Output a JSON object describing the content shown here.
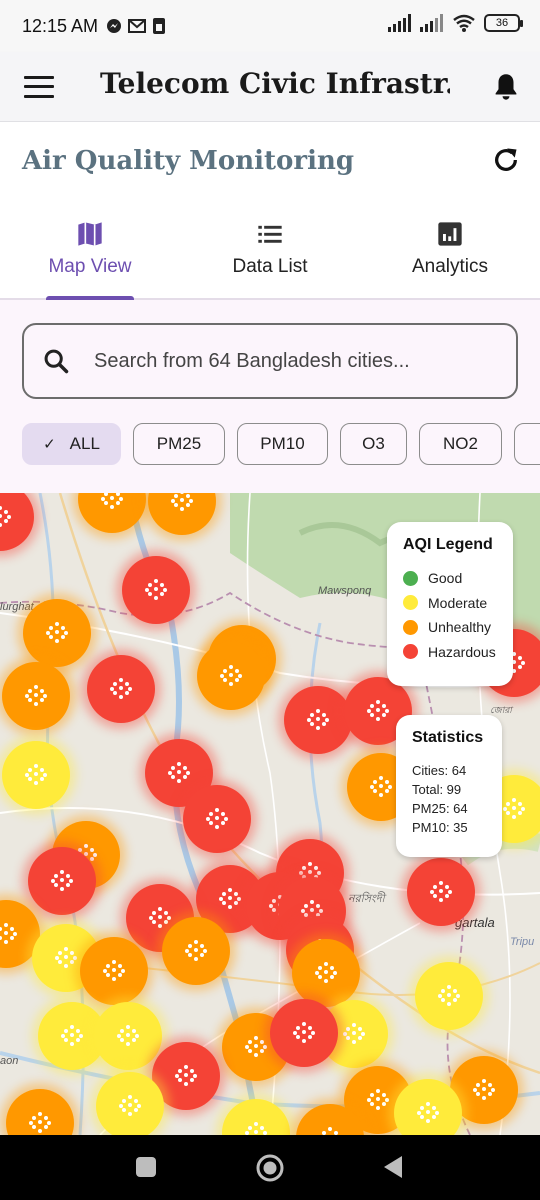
{
  "status_bar": {
    "time": "12:15 AM",
    "battery": "36",
    "icons": [
      "messenger-icon",
      "gmail-icon",
      "sim-icon",
      "signal-icon",
      "signal-icon",
      "wifi-icon",
      "battery-icon"
    ]
  },
  "app_bar": {
    "title": "Telecom Civic Infrastr...",
    "menu_icon": "hamburger-menu-icon",
    "notification_icon": "bell-icon"
  },
  "section": {
    "title": "Air Quality Monitoring",
    "refresh_icon": "refresh-icon"
  },
  "tabs": [
    {
      "label": "Map View",
      "icon": "map-icon",
      "active": true
    },
    {
      "label": "Data List",
      "icon": "list-icon",
      "active": false
    },
    {
      "label": "Analytics",
      "icon": "analytics-icon",
      "active": false
    }
  ],
  "search": {
    "placeholder": "Search from 64 Bangladesh cities..."
  },
  "filters": [
    {
      "label": "ALL",
      "selected": true
    },
    {
      "label": "PM25",
      "selected": false
    },
    {
      "label": "PM10",
      "selected": false
    },
    {
      "label": "O3",
      "selected": false
    },
    {
      "label": "NO2",
      "selected": false
    }
  ],
  "map": {
    "place_labels": [
      "Mawsponq",
      "lurghat",
      "নরসিংদী",
      "gartala",
      "Tripu",
      "aon",
      "জোরা"
    ],
    "legend": {
      "title": "AQI Legend",
      "items": [
        {
          "label": "Good",
          "color": "#4caf50"
        },
        {
          "label": "Moderate",
          "color": "#ffeb3b"
        },
        {
          "label": "Unhealthy",
          "color": "#ff9800"
        },
        {
          "label": "Hazardous",
          "color": "#f44336"
        }
      ]
    },
    "statistics": {
      "title": "Statistics",
      "lines": [
        "Cities: 64",
        "Total: 99",
        "PM25: 64",
        "PM10: 35"
      ]
    }
  },
  "colors": {
    "accent": "#6d4fb0",
    "section_title": "#5b7280",
    "hazardous": "#f44336",
    "unhealthy": "#ff9800",
    "moderate": "#ffeb3b",
    "good": "#4caf50"
  },
  "nav_bar": {
    "buttons": [
      "recents-button",
      "home-button",
      "back-button"
    ]
  }
}
